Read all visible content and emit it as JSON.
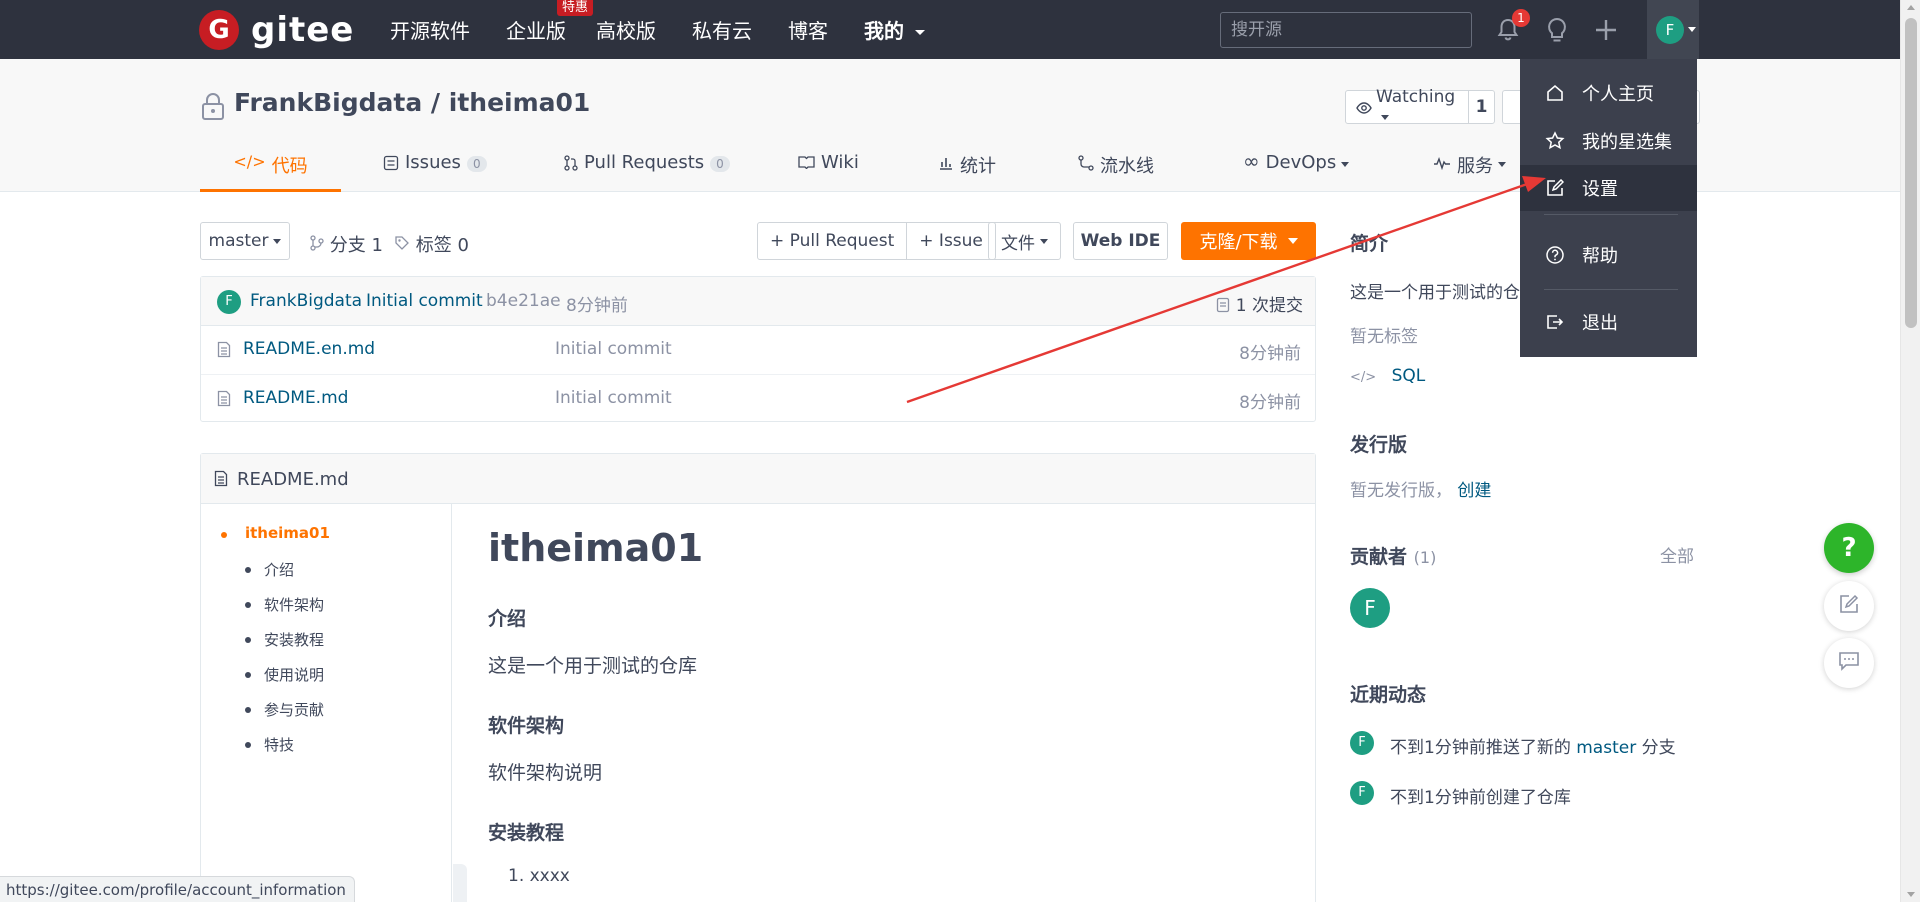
{
  "topnav": {
    "logo_mark": "G",
    "logo_text": "gitee",
    "links": [
      "开源软件",
      "企业版",
      "高校版",
      "私有云",
      "博客",
      "我的"
    ],
    "promo_badge": "特惠",
    "search_placeholder": "搜开源",
    "notification_count": "1",
    "avatar_initial": "F"
  },
  "repo": {
    "title": "FrankBigdata / itheima01",
    "watch_label": "Watching",
    "watch_count": "1"
  },
  "tabs": [
    {
      "label": "代码",
      "icon": "code-icon"
    },
    {
      "label": "Issues",
      "count": "0",
      "icon": "issues-icon"
    },
    {
      "label": "Pull Requests",
      "count": "0",
      "icon": "pull-request-icon"
    },
    {
      "label": "Wiki",
      "icon": "wiki-icon"
    },
    {
      "label": "统计",
      "icon": "stats-icon"
    },
    {
      "label": "流水线",
      "icon": "pipeline-icon"
    },
    {
      "label": "DevOps",
      "icon": "devops-icon"
    },
    {
      "label": "服务",
      "icon": "service-icon"
    }
  ],
  "toolbar": {
    "branch": "master",
    "branches": "分支 1",
    "tags": "标签 0",
    "pull_request": "+ Pull Request",
    "issue": "+ Issue",
    "file": "文件",
    "web_ide": "Web IDE",
    "clone": "克隆/下载"
  },
  "commit": {
    "avatar": "F",
    "author": "FrankBigdata",
    "message": "Initial commit",
    "hash": "b4e21ae",
    "time": "8分钟前",
    "count": "1 次提交"
  },
  "files": [
    {
      "name": "README.en.md",
      "message": "Initial commit",
      "time": "8分钟前"
    },
    {
      "name": "README.md",
      "message": "Initial commit",
      "time": "8分钟前"
    }
  ],
  "readme": {
    "filename": "README.md",
    "toc": [
      "itheima01",
      "介绍",
      "软件架构",
      "安装教程",
      "使用说明",
      "参与贡献",
      "特技"
    ],
    "h1": "itheima01",
    "intro_h": "介绍",
    "intro_p": "这是一个用于测试的仓库",
    "arch_h": "软件架构",
    "arch_p": "软件架构说明",
    "install_h": "安装教程",
    "install_item": "1. xxxx"
  },
  "sidebar": {
    "intro_h": "简介",
    "intro_text": "这是一个用于测试的仓",
    "no_tags": "暂无标签",
    "lang": "SQL",
    "release_h": "发行版",
    "no_release": "暂无发行版，",
    "create": "创建",
    "contrib_h": "贡献者",
    "contrib_count": "(1)",
    "all": "全部",
    "contrib_avatar": "F",
    "activity_h": "近期动态",
    "act1_pre": "不到1分钟前推送了新的",
    "act1_branch": "master",
    "act1_post": "分支",
    "act2": "不到1分钟前创建了仓库"
  },
  "dropdown": {
    "items": [
      {
        "label": "个人主页",
        "icon": "home-icon"
      },
      {
        "label": "我的星选集",
        "icon": "star-icon"
      },
      {
        "label": "设置",
        "icon": "edit-icon"
      },
      {
        "label": "帮助",
        "icon": "help-icon"
      },
      {
        "label": "退出",
        "icon": "logout-icon"
      }
    ]
  },
  "fab_help": "?",
  "status_url": "https://gitee.com/profile/account_information",
  "colors": {
    "nav_bg": "#2e323e",
    "brand_red": "#c71d23",
    "accent_orange": "#fe7300",
    "link_blue": "#005980",
    "avatar_green": "#1e9e82",
    "help_green": "#2db52a",
    "annotation_arrow": "#e53935"
  }
}
